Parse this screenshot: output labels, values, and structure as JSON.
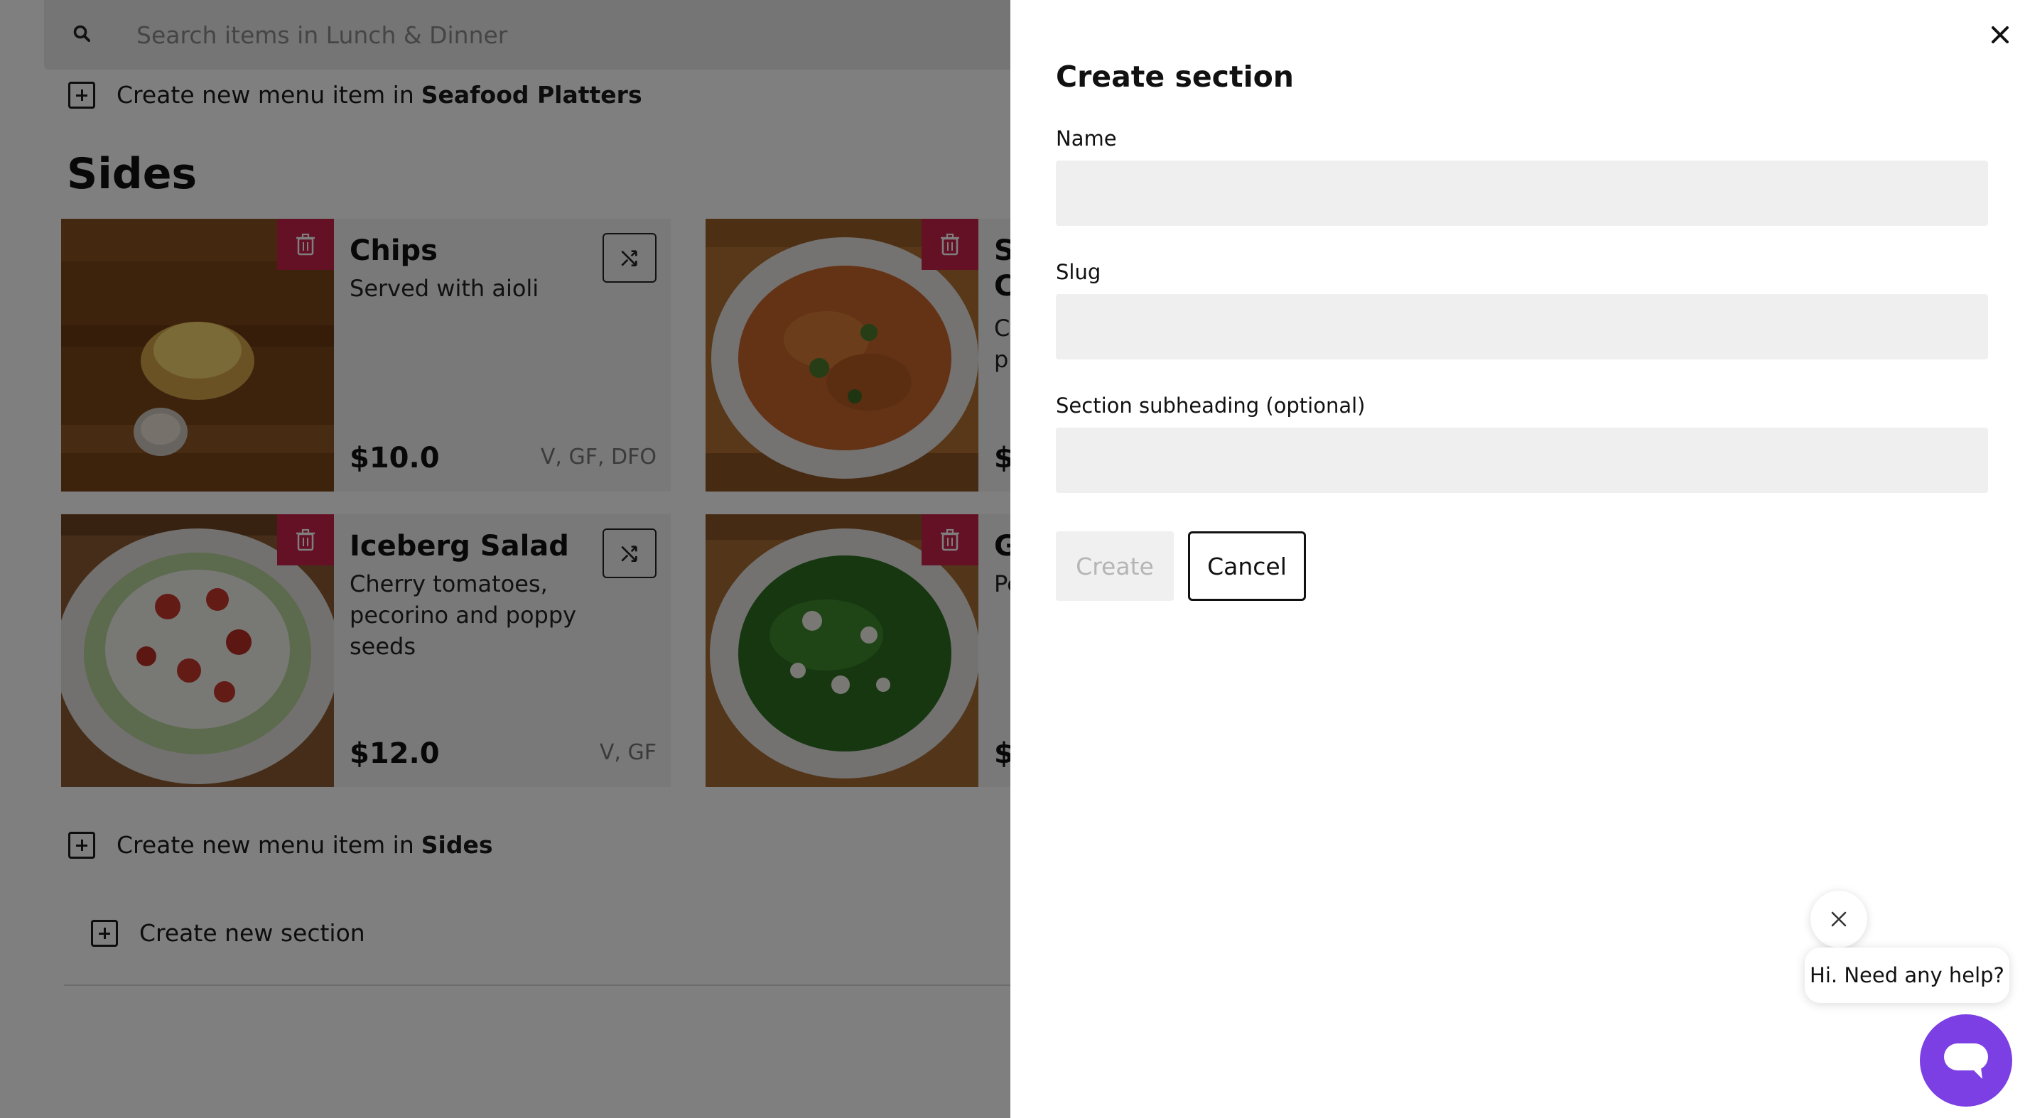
{
  "search": {
    "placeholder": "Search items in Lunch & Dinner"
  },
  "top_create": {
    "prefix": "Create new menu item in",
    "section": "Seafood Platters"
  },
  "section": {
    "title": "Sides"
  },
  "cards": [
    {
      "name": "Chips",
      "desc": "Served with aioli",
      "price": "$10.0",
      "tags": "V, GF, DFO"
    },
    {
      "name": "S",
      "subname": "C",
      "desc": "C",
      "desc2": "pi",
      "price": "$"
    },
    {
      "name": "Iceberg Salad",
      "desc": "Cherry tomatoes, pecorino and poppy seeds",
      "price": "$12.0",
      "tags": "V, GF"
    },
    {
      "name": "G",
      "desc": "Pe",
      "price": "$"
    }
  ],
  "sides_create": {
    "prefix": "Create new menu item in",
    "section": "Sides"
  },
  "new_section": {
    "label": "Create new section"
  },
  "drawer": {
    "title": "Create section",
    "name_label": "Name",
    "slug_label": "Slug",
    "subheading_label": "Section subheading (optional)",
    "create_label": "Create",
    "cancel_label": "Cancel"
  },
  "chat": {
    "message": "Hi. Need any help?"
  },
  "colors": {
    "accent_delete": "#c8234a",
    "chat_launcher": "#7b3fe4",
    "overlay": "rgba(0,0,0,0.5)"
  }
}
